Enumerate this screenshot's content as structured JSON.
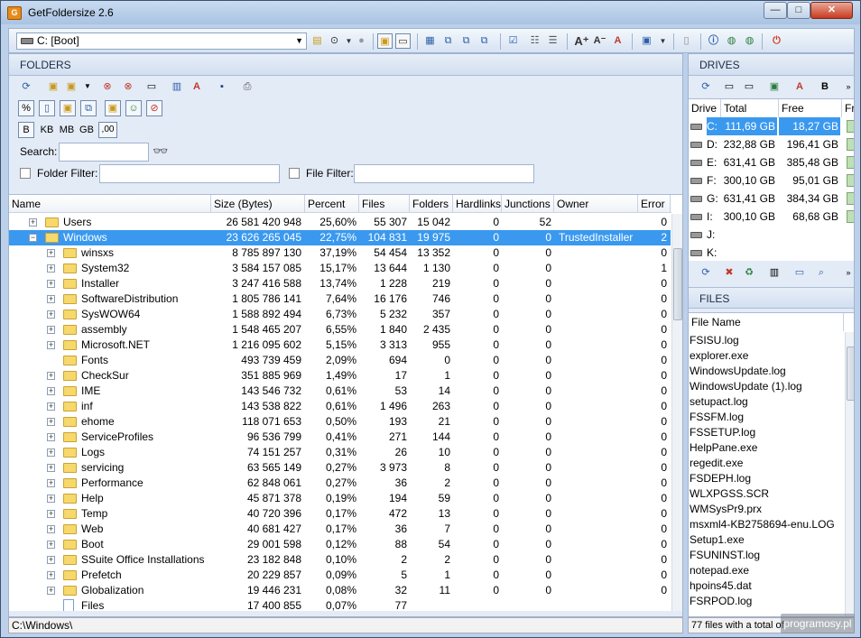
{
  "app": {
    "title": "GetFoldersize 2.6"
  },
  "window_controls": {
    "minimize": "—",
    "maximize": "□",
    "close": "✕"
  },
  "toolbar": {
    "drive_value": "C: [Boot]"
  },
  "folders_panel": {
    "title": "FOLDERS",
    "size_units": [
      "B",
      "KB",
      "MB",
      "GB",
      ",00"
    ],
    "search_label": "Search:",
    "search_value": "",
    "folder_filter_label": "Folder Filter:",
    "folder_filter_value": "",
    "file_filter_label": "File Filter:",
    "file_filter_value": "",
    "columns": [
      "Name",
      "Size (Bytes)",
      "Percent",
      "Files",
      "Folders",
      "Hardlinks",
      "Junctions",
      "Owner",
      "Error"
    ],
    "rows": [
      {
        "name": "Users",
        "size": "26 581 420 948",
        "percent": "25,60%",
        "files": "55 307",
        "folders": "15 042",
        "hardlinks": "0",
        "junctions": "52",
        "owner": "",
        "error": "0"
      },
      {
        "name": "Windows",
        "size": "23 626 265 045",
        "percent": "22,75%",
        "files": "104 831",
        "folders": "19 975",
        "hardlinks": "0",
        "junctions": "0",
        "owner": "TrustedInstaller",
        "error": "2"
      },
      {
        "name": "winsxs",
        "size": "8 785 897 130",
        "percent": "37,19%",
        "files": "54 454",
        "folders": "13 352",
        "hardlinks": "0",
        "junctions": "0",
        "owner": "",
        "error": "0"
      },
      {
        "name": "System32",
        "size": "3 584 157 085",
        "percent": "15,17%",
        "files": "13 644",
        "folders": "1 130",
        "hardlinks": "0",
        "junctions": "0",
        "owner": "",
        "error": "1"
      },
      {
        "name": "Installer",
        "size": "3 247 416 588",
        "percent": "13,74%",
        "files": "1 228",
        "folders": "219",
        "hardlinks": "0",
        "junctions": "0",
        "owner": "",
        "error": "0"
      },
      {
        "name": "SoftwareDistribution",
        "size": "1 805 786 141",
        "percent": "7,64%",
        "files": "16 176",
        "folders": "746",
        "hardlinks": "0",
        "junctions": "0",
        "owner": "",
        "error": "0"
      },
      {
        "name": "SysWOW64",
        "size": "1 588 892 494",
        "percent": "6,73%",
        "files": "5 232",
        "folders": "357",
        "hardlinks": "0",
        "junctions": "0",
        "owner": "",
        "error": "0"
      },
      {
        "name": "assembly",
        "size": "1 548 465 207",
        "percent": "6,55%",
        "files": "1 840",
        "folders": "2 435",
        "hardlinks": "0",
        "junctions": "0",
        "owner": "",
        "error": "0"
      },
      {
        "name": "Microsoft.NET",
        "size": "1 216 095 602",
        "percent": "5,15%",
        "files": "3 313",
        "folders": "955",
        "hardlinks": "0",
        "junctions": "0",
        "owner": "",
        "error": "0"
      },
      {
        "name": "Fonts",
        "size": "493 739 459",
        "percent": "2,09%",
        "files": "694",
        "folders": "0",
        "hardlinks": "0",
        "junctions": "0",
        "owner": "",
        "error": "0"
      },
      {
        "name": "CheckSur",
        "size": "351 885 969",
        "percent": "1,49%",
        "files": "17",
        "folders": "1",
        "hardlinks": "0",
        "junctions": "0",
        "owner": "",
        "error": "0"
      },
      {
        "name": "IME",
        "size": "143 546 732",
        "percent": "0,61%",
        "files": "53",
        "folders": "14",
        "hardlinks": "0",
        "junctions": "0",
        "owner": "",
        "error": "0"
      },
      {
        "name": "inf",
        "size": "143 538 822",
        "percent": "0,61%",
        "files": "1 496",
        "folders": "263",
        "hardlinks": "0",
        "junctions": "0",
        "owner": "",
        "error": "0"
      },
      {
        "name": "ehome",
        "size": "118 071 653",
        "percent": "0,50%",
        "files": "193",
        "folders": "21",
        "hardlinks": "0",
        "junctions": "0",
        "owner": "",
        "error": "0"
      },
      {
        "name": "ServiceProfiles",
        "size": "96 536 799",
        "percent": "0,41%",
        "files": "271",
        "folders": "144",
        "hardlinks": "0",
        "junctions": "0",
        "owner": "",
        "error": "0"
      },
      {
        "name": "Logs",
        "size": "74 151 257",
        "percent": "0,31%",
        "files": "26",
        "folders": "10",
        "hardlinks": "0",
        "junctions": "0",
        "owner": "",
        "error": "0"
      },
      {
        "name": "servicing",
        "size": "63 565 149",
        "percent": "0,27%",
        "files": "3 973",
        "folders": "8",
        "hardlinks": "0",
        "junctions": "0",
        "owner": "",
        "error": "0"
      },
      {
        "name": "Performance",
        "size": "62 848 061",
        "percent": "0,27%",
        "files": "36",
        "folders": "2",
        "hardlinks": "0",
        "junctions": "0",
        "owner": "",
        "error": "0"
      },
      {
        "name": "Help",
        "size": "45 871 378",
        "percent": "0,19%",
        "files": "194",
        "folders": "59",
        "hardlinks": "0",
        "junctions": "0",
        "owner": "",
        "error": "0"
      },
      {
        "name": "Temp",
        "size": "40 720 396",
        "percent": "0,17%",
        "files": "472",
        "folders": "13",
        "hardlinks": "0",
        "junctions": "0",
        "owner": "",
        "error": "0"
      },
      {
        "name": "Web",
        "size": "40 681 427",
        "percent": "0,17%",
        "files": "36",
        "folders": "7",
        "hardlinks": "0",
        "junctions": "0",
        "owner": "",
        "error": "0"
      },
      {
        "name": "Boot",
        "size": "29 001 598",
        "percent": "0,12%",
        "files": "88",
        "folders": "54",
        "hardlinks": "0",
        "junctions": "0",
        "owner": "",
        "error": "0"
      },
      {
        "name": "SSuite Office Installations",
        "size": "23 182 848",
        "percent": "0,10%",
        "files": "2",
        "folders": "2",
        "hardlinks": "0",
        "junctions": "0",
        "owner": "",
        "error": "0"
      },
      {
        "name": "Prefetch",
        "size": "20 229 857",
        "percent": "0,09%",
        "files": "5",
        "folders": "1",
        "hardlinks": "0",
        "junctions": "0",
        "owner": "",
        "error": "0"
      },
      {
        "name": "Globalization",
        "size": "19 446 231",
        "percent": "0,08%",
        "files": "32",
        "folders": "11",
        "hardlinks": "0",
        "junctions": "0",
        "owner": "",
        "error": "0"
      },
      {
        "name": "Files",
        "size": "17 400 855",
        "percent": "0,07%",
        "files": "77",
        "folders": "",
        "hardlinks": "",
        "junctions": "",
        "owner": "",
        "error": ""
      }
    ],
    "status": "C:\\Windows\\"
  },
  "drives_panel": {
    "title": "DRIVES",
    "columns": [
      "Drive",
      "Total",
      "Free",
      "Fr"
    ],
    "rows": [
      {
        "drive": "C:",
        "total": "111,69 GB",
        "free": "18,27 GB"
      },
      {
        "drive": "D:",
        "total": "232,88 GB",
        "free": "196,41 GB"
      },
      {
        "drive": "E:",
        "total": "631,41 GB",
        "free": "385,48 GB"
      },
      {
        "drive": "F:",
        "total": "300,10 GB",
        "free": "95,01 GB"
      },
      {
        "drive": "G:",
        "total": "631,41 GB",
        "free": "384,34 GB"
      },
      {
        "drive": "I:",
        "total": "300,10 GB",
        "free": "68,68 GB"
      },
      {
        "drive": "J:",
        "total": "",
        "free": ""
      },
      {
        "drive": "K:",
        "total": "",
        "free": ""
      }
    ],
    "bold_label": "B"
  },
  "files_panel": {
    "title": "FILES",
    "column": "File Name",
    "rows": [
      "FSISU.log",
      "explorer.exe",
      "WindowsUpdate.log",
      "WindowsUpdate (1).log",
      "setupact.log",
      "FSSFM.log",
      "FSSETUP.log",
      "HelpPane.exe",
      "regedit.exe",
      "FSDEPH.log",
      "WLXPGSS.SCR",
      "WMSysPr9.prx",
      "msxml4-KB2758694-enu.LOG",
      "Setup1.exe",
      "FSUNINST.log",
      "notepad.exe",
      "hpoins45.dat",
      "FSRPOD.log"
    ],
    "status": "77 files with a total of"
  },
  "watermark": "programosy.pl"
}
